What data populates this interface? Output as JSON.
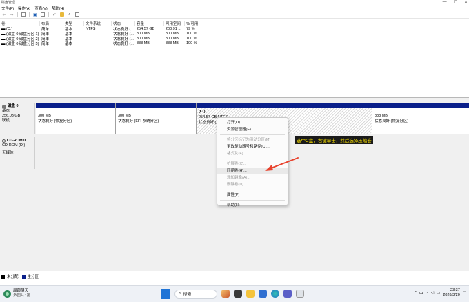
{
  "window": {
    "title": "磁盘管理",
    "controls": [
      "—",
      "☐",
      "✕"
    ]
  },
  "menu": [
    "文件(F)",
    "操作(A)",
    "查看(V)",
    "帮助(H)"
  ],
  "volumes": {
    "headers": [
      "卷",
      "布局",
      "类型",
      "文件系统",
      "状态",
      "容量",
      "可用空间",
      "% 可用"
    ],
    "rows": [
      [
        "(C:)",
        "简单",
        "基本",
        "NTFS",
        "状态良好 (...",
        "254.57 GB",
        "200.91 ...",
        "79 %"
      ],
      [
        "(磁盘 0 磁盘分区 1)",
        "简单",
        "基本",
        "",
        "状态良好 (...",
        "300 MB",
        "300 MB",
        "100 %"
      ],
      [
        "(磁盘 0 磁盘分区 2)",
        "简单",
        "基本",
        "",
        "状态良好 (...",
        "300 MB",
        "300 MB",
        "100 %"
      ],
      [
        "(磁盘 0 磁盘分区 5)",
        "简单",
        "基本",
        "",
        "状态良好 (...",
        "888 MB",
        "888 MB",
        "100 %"
      ]
    ]
  },
  "disk0": {
    "name": "磁盘 0",
    "type": "基本",
    "size": "256.03 GB",
    "status": "联机",
    "partitions": [
      {
        "size": "300 MB",
        "status": "状态良好 (恢复分区)"
      },
      {
        "size": "300 MB",
        "status": "状态良好 (EFI 系统分区)"
      },
      {
        "name": "(C:)",
        "size": "254.57 GB NTFS",
        "status": "状态良好 (启..."
      },
      {
        "size": "888 MB",
        "status": "状态良好 (恢复分区)"
      }
    ]
  },
  "cdrom0": {
    "name": "CD-ROM 0",
    "drive": "CD-ROM (D:)",
    "media": "无媒体"
  },
  "context_menu": {
    "items": [
      {
        "label": "打开(O)",
        "disabled": false
      },
      {
        "label": "资源管理器(E)",
        "disabled": false
      },
      {
        "sep": true
      },
      {
        "label": "将分区标记为活动分区(M)",
        "disabled": true
      },
      {
        "label": "更改驱动器号和路径(C)...",
        "disabled": false
      },
      {
        "label": "格式化(F)...",
        "disabled": true
      },
      {
        "sep": true
      },
      {
        "label": "扩展卷(X)...",
        "disabled": true
      },
      {
        "label": "压缩卷(H)...",
        "disabled": false,
        "highlight": true
      },
      {
        "label": "添加镜像(A)...",
        "disabled": true
      },
      {
        "label": "删除卷(D)...",
        "disabled": true
      },
      {
        "sep": true
      },
      {
        "label": "属性(P)",
        "disabled": false
      },
      {
        "sep": true
      },
      {
        "label": "帮助(H)",
        "disabled": false
      }
    ]
  },
  "annotation": "选中C盘，右键单击，然后选择压缩卷",
  "legend": [
    "未分配",
    "主分区"
  ],
  "taskbar": {
    "weather_title": "局部阴天",
    "weather_sub": "多图片: 第二...",
    "search_placeholder": "搜索",
    "tray_lang": "中",
    "time": "23:37",
    "date": "2026/3/20"
  },
  "colors": {
    "partition_bar": "#0a1f8a",
    "annotation_bg": "#1a1a1a",
    "annotation_text": "#ffe600",
    "arrow": "#e8432e"
  }
}
